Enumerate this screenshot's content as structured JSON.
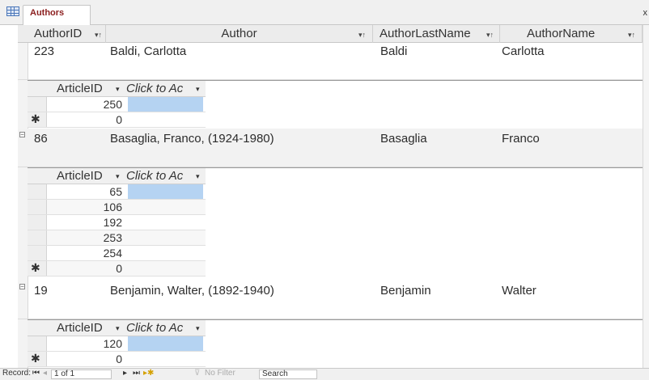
{
  "tab": {
    "label": "Authors",
    "close": "x"
  },
  "columns": [
    {
      "label": "AuthorID",
      "sort": "▾↑"
    },
    {
      "label": "Author",
      "sort": "▾↑"
    },
    {
      "label": "AuthorLastName",
      "sort": "▾↑"
    },
    {
      "label": "AuthorName",
      "sort": "▾↑"
    }
  ],
  "subcolumns": {
    "id": "ArticleID",
    "id_sort": "▾",
    "add": "Click to Ac",
    "add_sort": "▾"
  },
  "records": [
    {
      "id": "223",
      "author": "Baldi, Carlotta",
      "last": "Baldi",
      "name": "Carlotta",
      "articles": [
        "250"
      ],
      "new_row": "0"
    },
    {
      "id": "86",
      "author": "Basaglia, Franco, (1924-1980)",
      "last": "Basaglia",
      "name": "Franco",
      "articles": [
        "65",
        "106",
        "192",
        "253",
        "254"
      ],
      "new_row": "0"
    },
    {
      "id": "19",
      "author": "Benjamin, Walter, (1892-1940)",
      "last": "Benjamin",
      "name": "Walter",
      "articles": [
        "120"
      ],
      "new_row": "0"
    }
  ],
  "status": {
    "record_label": "Record:",
    "position": "1 of 1",
    "filter": "No Filter",
    "search": "Search"
  },
  "colors": {
    "tab_text": "#8b1e1e",
    "selection": "#b5d3f2",
    "header_bg": "#ececec"
  }
}
